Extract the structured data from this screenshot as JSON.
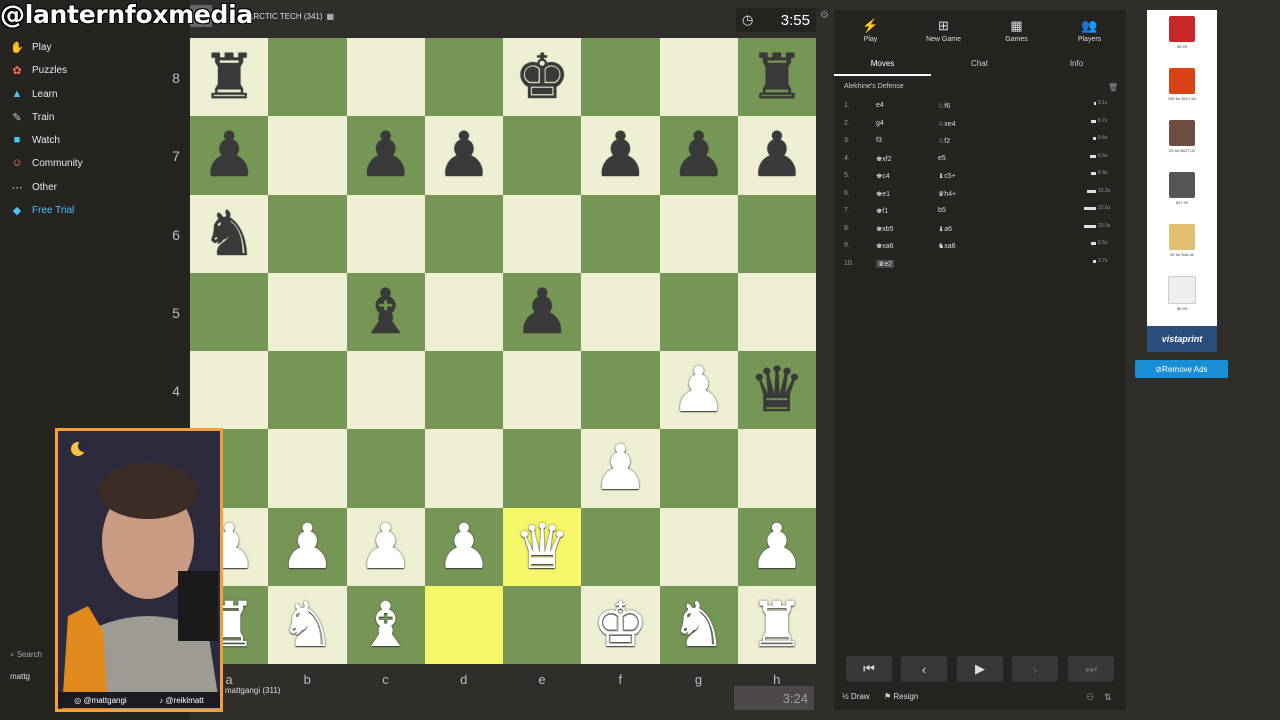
{
  "overlay": {
    "handle": "@lanternfoxmedia"
  },
  "sidebar": {
    "items": [
      {
        "label": "Play",
        "icon": "play-icon"
      },
      {
        "label": "Puzzles",
        "icon": "puzzle-icon"
      },
      {
        "label": "Learn",
        "icon": "learn-icon"
      },
      {
        "label": "Train",
        "icon": "train-icon"
      },
      {
        "label": "Watch",
        "icon": "watch-icon"
      },
      {
        "label": "Community",
        "icon": "community-icon"
      },
      {
        "label": "Other",
        "icon": "more-icon"
      },
      {
        "label": "Free Trial",
        "icon": "diamond-icon"
      }
    ],
    "search": "Search",
    "user": "mattg"
  },
  "top_player": {
    "name": "ARCTIC TECH (341)",
    "clock": "3:55"
  },
  "bottom_player": {
    "name": "mattgangi (311)",
    "clock": "3:24"
  },
  "board": {
    "ranks": [
      "8",
      "7",
      "6",
      "5",
      "4",
      "3",
      "2",
      "1"
    ],
    "files": [
      "a",
      "b",
      "c",
      "d",
      "e",
      "f",
      "g",
      "h"
    ],
    "highlight": [
      "e2",
      "d1"
    ],
    "pieces": {
      "a8": "br",
      "e8": "bk",
      "h8": "br",
      "a7": "bp",
      "c7": "bp",
      "d7": "bp",
      "f7": "bp",
      "g7": "bp",
      "h7": "bp",
      "a6": "bn",
      "c5": "bb",
      "e5": "bp",
      "g4": "wp",
      "h4": "bq",
      "f3": "wp",
      "a2": "wp",
      "b2": "wp",
      "c2": "wp",
      "d2": "wp",
      "e2": "wq",
      "h2": "wp",
      "a1": "wr",
      "b1": "wn",
      "c1": "wb",
      "f1": "wk",
      "g1": "wn",
      "h1": "wr"
    }
  },
  "panel": {
    "tabs": [
      {
        "label": "Play",
        "icon": "bolt-icon"
      },
      {
        "label": "New Game",
        "icon": "plus-icon"
      },
      {
        "label": "Games",
        "icon": "grid-icon"
      },
      {
        "label": "Players",
        "icon": "players-icon"
      }
    ],
    "subtabs": [
      "Moves",
      "Chat",
      "Info"
    ],
    "opening": "Alekhine's Defense",
    "moves": [
      {
        "n": "1.",
        "w": "e4",
        "b": "♘f6",
        "t": "0.1s"
      },
      {
        "n": "2.",
        "w": "g4",
        "b": "♘xe4",
        "t": "8.7s"
      },
      {
        "n": "3.",
        "w": "f3",
        "b": "♘f2",
        "t": "0.4s"
      },
      {
        "n": "4.",
        "w": "♚xf2",
        "b": "e5",
        "t": "6.5s"
      },
      {
        "n": "5.",
        "w": "♚c4",
        "b": "♝c5+",
        "t": "8.4s"
      },
      {
        "n": "6.",
        "w": "♚e1",
        "b": "♛h4+",
        "t": "10.2s"
      },
      {
        "n": "7.",
        "w": "♚f1",
        "b": "b5",
        "t": "22.6s"
      },
      {
        "n": "8.",
        "w": "♚xb5",
        "b": "♝a6",
        "t": "23.0s"
      },
      {
        "n": "9.",
        "w": "♚xa6",
        "b": "♞xa6",
        "t": "5.5s"
      },
      {
        "n": "10.",
        "w": "♛e2",
        "b": "",
        "t": "3.7s"
      }
    ],
    "draw": "Draw",
    "resign": "Resign"
  },
  "ads": {
    "prices": [
      "$9.99",
      "250 for $107.50",
      "25 for $627.00",
      "$37.99",
      "50 for $46.46",
      "$9.99"
    ],
    "brand": "vistaprint",
    "remove": "Remove Ads"
  },
  "social": {
    "a": "@mattgangi",
    "b": "@reikimatt"
  }
}
